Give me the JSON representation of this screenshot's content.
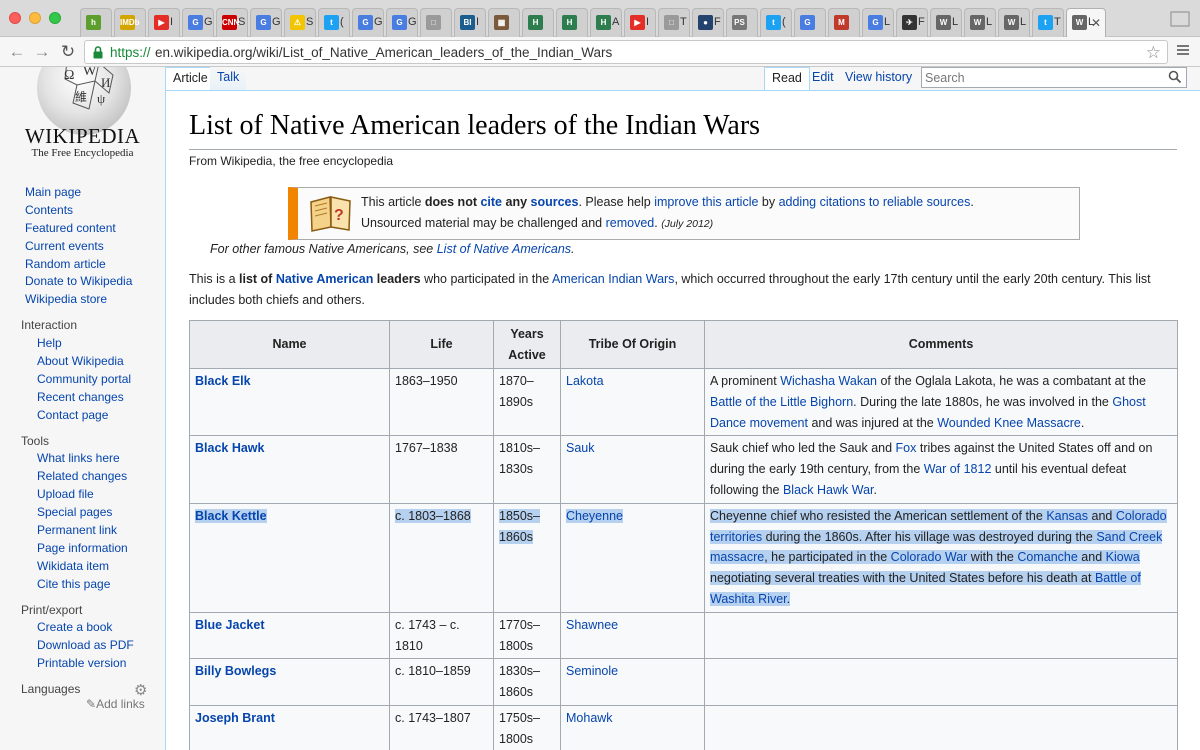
{
  "browser": {
    "tabs": [
      {
        "label": "",
        "fav": "h",
        "color": "#5d9e2e"
      },
      {
        "label": "",
        "fav": "IMDb",
        "color": "#d4a500"
      },
      {
        "label": "I",
        "fav": "▶",
        "color": "#e52d27"
      },
      {
        "label": "G",
        "fav": "G",
        "color": "#4a7de2"
      },
      {
        "label": "S",
        "fav": "CNN",
        "color": "#cc0000"
      },
      {
        "label": "G",
        "fav": "G",
        "color": "#4a7de2"
      },
      {
        "label": "S",
        "fav": "⚠",
        "color": "#f2c500"
      },
      {
        "label": "(",
        "fav": "t",
        "color": "#1da1f2"
      },
      {
        "label": "G",
        "fav": "G",
        "color": "#4a7de2"
      },
      {
        "label": "G",
        "fav": "G",
        "color": "#4a7de2"
      },
      {
        "label": "",
        "fav": "□",
        "color": "#9a9a9a"
      },
      {
        "label": "I",
        "fav": "BI",
        "color": "#1c5d8f"
      },
      {
        "label": "",
        "fav": "▦",
        "color": "#7a5a3a"
      },
      {
        "label": "",
        "fav": "H",
        "color": "#2e7d4f"
      },
      {
        "label": "",
        "fav": "H",
        "color": "#2e7d4f"
      },
      {
        "label": "A",
        "fav": "H",
        "color": "#2e7d4f"
      },
      {
        "label": "I",
        "fav": "▶",
        "color": "#e52d27"
      },
      {
        "label": "T",
        "fav": "□",
        "color": "#9a9a9a"
      },
      {
        "label": "F",
        "fav": "●",
        "color": "#23426e"
      },
      {
        "label": "",
        "fav": "PS",
        "color": "#777777"
      },
      {
        "label": "(",
        "fav": "t",
        "color": "#1da1f2"
      },
      {
        "label": "",
        "fav": "G",
        "color": "#4a7de2"
      },
      {
        "label": "",
        "fav": "M",
        "color": "#c0392b"
      },
      {
        "label": "L",
        "fav": "G",
        "color": "#4a7de2"
      },
      {
        "label": "F",
        "fav": "✈",
        "color": "#333333"
      },
      {
        "label": "L",
        "fav": "W",
        "color": "#666666"
      },
      {
        "label": "L",
        "fav": "W",
        "color": "#666666"
      },
      {
        "label": "L",
        "fav": "W",
        "color": "#666666"
      },
      {
        "label": "T",
        "fav": "t",
        "color": "#1da1f2"
      },
      {
        "label": "L",
        "fav": "W",
        "color": "#666666"
      }
    ],
    "url_scheme": "https://",
    "url_rest": "en.wikipedia.org/wiki/List_of_Native_American_leaders_of_the_Indian_Wars"
  },
  "wiki": {
    "wordmark": "WIKIPEDIA",
    "tagline": "The Free Encyclopedia",
    "nav": [
      "Main page",
      "Contents",
      "Featured content",
      "Current events",
      "Random article",
      "Donate to Wikipedia",
      "Wikipedia store"
    ],
    "interaction_head": "Interaction",
    "interaction": [
      "Help",
      "About Wikipedia",
      "Community portal",
      "Recent changes",
      "Contact page"
    ],
    "tools_head": "Tools",
    "tools": [
      "What links here",
      "Related changes",
      "Upload file",
      "Special pages",
      "Permanent link",
      "Page information",
      "Wikidata item",
      "Cite this page"
    ],
    "print_head": "Print/export",
    "print": [
      "Create a book",
      "Download as PDF",
      "Printable version"
    ],
    "languages_head": "Languages",
    "add_links": "Add links"
  },
  "page_tabs": {
    "article": "Article",
    "talk": "Talk",
    "read": "Read",
    "edit": "Edit",
    "history": "View history"
  },
  "search": {
    "placeholder": "Search"
  },
  "article": {
    "title": "List of Native American leaders of the Indian Wars",
    "site_sub": "From Wikipedia, the free encyclopedia",
    "ambox": {
      "t1": "This article ",
      "t2": "does not ",
      "t3": "cite",
      "t4": " any ",
      "t5": "sources",
      "t6": ". Please help ",
      "t7": "improve this article",
      "t8": " by ",
      "t9": "adding citations to reliable sources",
      "t10": ".",
      "u1": "Unsourced material may be challenged and ",
      "u2": "removed",
      "u3": ". ",
      "date": "(July 2012)"
    },
    "hatnote": {
      "prefix": "For other famous Native Americans, see ",
      "link": "List of Native Americans",
      "suffix": "."
    },
    "intro": {
      "a": "This is a ",
      "b": "list of ",
      "c": "Native American",
      "d": " leaders",
      "e": " who participated in the ",
      "f": "American Indian Wars",
      "g": ", which occurred throughout the early 17th century until the early 20th century. This list includes both chiefs and others."
    }
  },
  "table": {
    "headers": [
      "Name",
      "Life",
      "Years Active",
      "Tribe Of Origin",
      "Comments"
    ],
    "rows": [
      {
        "name": "Black Elk",
        "life": "1863–1950",
        "years": "1870–1890s",
        "tribe": "Lakota",
        "comment": [
          [
            "A prominent ",
            0
          ],
          [
            "Wichasha Wakan",
            1
          ],
          [
            " of the Oglala Lakota, he was a combatant at the ",
            0
          ],
          [
            "Battle of the Little Bighorn",
            1
          ],
          [
            ". During the late 1880s, he was involved in the ",
            0
          ],
          [
            "Ghost Dance movement",
            1
          ],
          [
            " and was injured at the ",
            0
          ],
          [
            "Wounded Knee Massacre",
            1
          ],
          [
            ".",
            0
          ]
        ]
      },
      {
        "name": "Black Hawk",
        "life": "1767–1838",
        "years": "1810s–1830s",
        "tribe": "Sauk",
        "comment": [
          [
            "Sauk chief who led the Sauk and ",
            0
          ],
          [
            "Fox",
            1
          ],
          [
            " tribes against the United States off and on during the early 19th century, from the ",
            0
          ],
          [
            "War of 1812",
            1
          ],
          [
            " until his eventual defeat following the ",
            0
          ],
          [
            "Black Hawk War",
            1
          ],
          [
            ".",
            0
          ]
        ]
      },
      {
        "name": "Black Kettle",
        "life": "c. 1803–1868",
        "years": "1850s–1860s",
        "tribe": "Cheyenne",
        "selected": true,
        "comment": [
          [
            "Cheyenne chief who resisted the American settlement of the ",
            0
          ],
          [
            "Kansas",
            1
          ],
          [
            " and ",
            0
          ],
          [
            "Colorado territories",
            1
          ],
          [
            " during the 1860s. After his village was destroyed during the ",
            0
          ],
          [
            "Sand Creek massacre",
            1
          ],
          [
            ", he participated in the ",
            0
          ],
          [
            "Colorado War",
            1
          ],
          [
            " with the ",
            0
          ],
          [
            "Comanche",
            1
          ],
          [
            " and ",
            0
          ],
          [
            "Kiowa",
            1
          ],
          [
            " negotiating several treaties with the United States before his death at ",
            0
          ],
          [
            "Battle of Washita River",
            1
          ],
          [
            ".",
            0
          ]
        ]
      },
      {
        "name": "Blue Jacket",
        "life": "c. 1743 – c. 1810",
        "years": "1770s–1800s",
        "tribe": "Shawnee",
        "comment": []
      },
      {
        "name": "Billy Bowlegs",
        "life": "c. 1810–1859",
        "years": "1830s–1860s",
        "tribe": "Seminole",
        "comment": []
      },
      {
        "name": "Joseph Brant",
        "life": "c. 1743–1807",
        "years": "1750s–1800s",
        "tribe": "Mohawk",
        "comment": []
      }
    ]
  },
  "colors": {
    "link": "#0645ad",
    "ambox_accent": "#f28500",
    "selection": "#b6d0f0",
    "https_green": "#1a8a3a"
  }
}
